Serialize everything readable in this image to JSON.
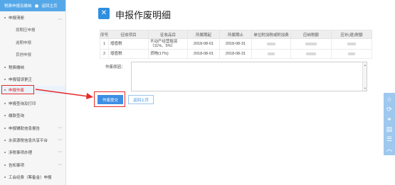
{
  "sidebar": {
    "top_links": [
      "税费申报及缴纳",
      "返回主页"
    ],
    "items": [
      {
        "label": "申报清册",
        "expanded": true
      },
      {
        "label": "按期应申报",
        "sub": true
      },
      {
        "label": "逾期申报",
        "sub": true
      },
      {
        "label": "其他申报",
        "sub": true
      },
      {
        "label": "税费缴纳"
      },
      {
        "label": "申报错误更正"
      },
      {
        "label": "申报作废",
        "active": true
      },
      {
        "label": "申报查询及打印"
      },
      {
        "label": "缴款查询"
      },
      {
        "label": "申报辅助信息报告",
        "expandable": true
      },
      {
        "label": "水资源税信息共享平台",
        "expandable": true
      },
      {
        "label": "涉税事项办理",
        "expandable": true
      },
      {
        "label": "告知事项",
        "expandable": true
      },
      {
        "label": "工会经费（筹备金）申报"
      }
    ]
  },
  "page": {
    "icon": "document-x-icon",
    "title": "申报作废明细"
  },
  "table": {
    "headers": [
      "序号",
      "征收项目",
      "征收品目",
      "所属期起",
      "所属期止",
      "单位附加税或附加费",
      "应纳税额",
      "应补(退)税额"
    ],
    "rows": [
      {
        "index": "1",
        "item": "增值税",
        "subitem": "不动产经营租赁（11%、5%）",
        "start": "2018-08-01",
        "end": "2018-08-31"
      },
      {
        "index": "2",
        "item": "增值税",
        "subitem": "货物(17%)",
        "start": "2018-08-01",
        "end": "2018-08-31"
      }
    ]
  },
  "remark": {
    "label": "作废原因：",
    "value": ""
  },
  "buttons": {
    "submit": "作废提交",
    "back": "返回上页"
  },
  "float_toolbar": {
    "icons": [
      "star-icon",
      "refresh-icon",
      "link-icon",
      "document-icon",
      "list-icon",
      "chevron-up-icon"
    ]
  },
  "colors": {
    "accent": "#3d8ee4",
    "sidebar_header": "#55a8e8",
    "highlight": "#e62a2a"
  }
}
